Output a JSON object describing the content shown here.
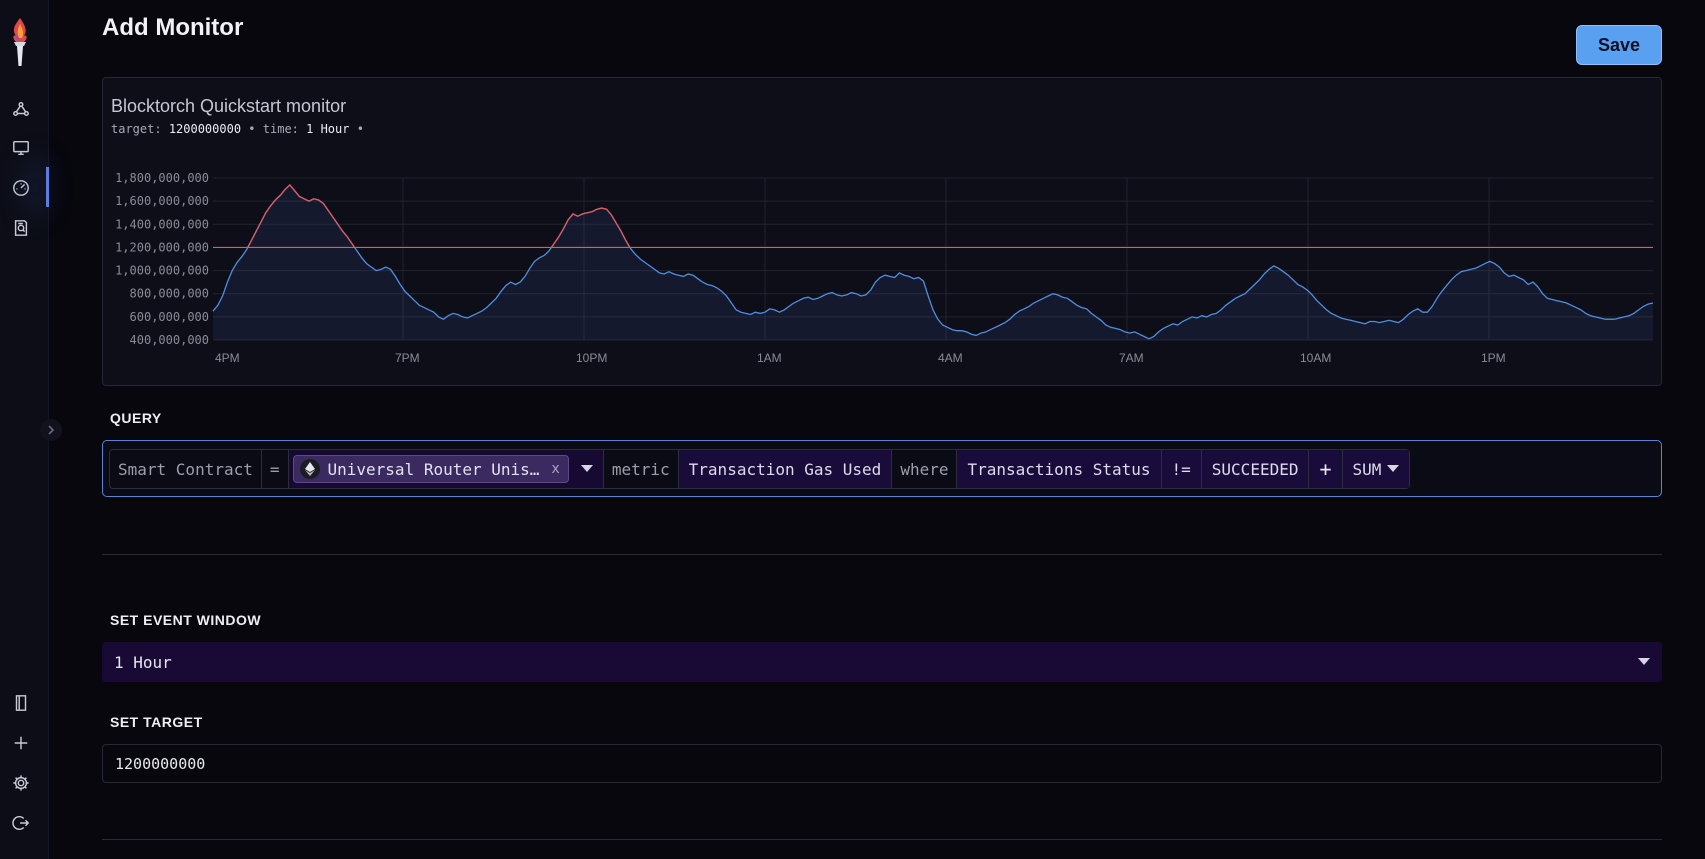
{
  "page": {
    "title": "Add Monitor",
    "save_label": "Save"
  },
  "sidebar": {
    "items": [
      {
        "name": "network",
        "icon": "network-icon"
      },
      {
        "name": "monitor",
        "icon": "desktop-icon"
      },
      {
        "name": "dashboard",
        "icon": "gauge-icon",
        "active": true
      },
      {
        "name": "reports",
        "icon": "document-search-icon"
      },
      {
        "name": "docs",
        "icon": "book-icon"
      },
      {
        "name": "add",
        "icon": "plus-icon"
      },
      {
        "name": "settings",
        "icon": "gear-icon"
      },
      {
        "name": "logout",
        "icon": "logout-icon"
      }
    ]
  },
  "chart_panel": {
    "title": "Blocktorch Quickstart monitor",
    "target_label": "target:",
    "target_value": "1200000000",
    "time_label": "time:",
    "time_value": "1 Hour",
    "separator": "•"
  },
  "chart_data": {
    "type": "line",
    "x_labels": [
      "4PM",
      "7PM",
      "10PM",
      "1AM",
      "4AM",
      "7AM",
      "10AM",
      "1PM"
    ],
    "y_ticks": [
      "1,800,000,000",
      "1,600,000,000",
      "1,400,000,000",
      "1,200,000,000",
      "1,000,000,000",
      "800,000,000",
      "600,000,000",
      "400,000,000"
    ],
    "ylim": [
      400000000,
      1800000000
    ],
    "threshold": 1200000000,
    "line_color": "#4f8ee0",
    "above_threshold_color": "#e05a5a",
    "grid": true,
    "series": [
      {
        "values": [
          650,
          700,
          780,
          900,
          1000,
          1070,
          1120,
          1180,
          1260,
          1340,
          1420,
          1500,
          1560,
          1610,
          1650,
          1700,
          1740,
          1690,
          1640,
          1620,
          1600,
          1620,
          1610,
          1580,
          1520,
          1460,
          1400,
          1340,
          1290,
          1230,
          1170,
          1110,
          1060,
          1030,
          1000,
          1010,
          1030,
          1010,
          950,
          880,
          820,
          780,
          740,
          700,
          680,
          660,
          640,
          600,
          580,
          610,
          630,
          620,
          600,
          590,
          610,
          630,
          650,
          680,
          720,
          760,
          820,
          870,
          900,
          880,
          900,
          950,
          1020,
          1080,
          1110,
          1130,
          1170,
          1230,
          1290,
          1360,
          1440,
          1490,
          1470,
          1490,
          1500,
          1510,
          1530,
          1540,
          1530,
          1480,
          1410,
          1340,
          1260,
          1190,
          1140,
          1100,
          1070,
          1040,
          1010,
          980,
          970,
          990,
          970,
          960,
          950,
          970,
          960,
          930,
          900,
          880,
          870,
          850,
          820,
          780,
          720,
          660,
          640,
          630,
          620,
          640,
          630,
          640,
          670,
          660,
          640,
          660,
          690,
          720,
          740,
          760,
          770,
          750,
          760,
          780,
          800,
          810,
          790,
          780,
          790,
          810,
          800,
          780,
          790,
          830,
          900,
          940,
          960,
          950,
          940,
          980,
          960,
          950,
          930,
          940,
          910,
          780,
          660,
          580,
          530,
          510,
          490,
          480,
          480,
          470,
          450,
          440,
          460,
          470,
          490,
          510,
          530,
          550,
          580,
          620,
          650,
          670,
          690,
          720,
          740,
          760,
          780,
          800,
          790,
          770,
          760,
          730,
          700,
          680,
          670,
          630,
          600,
          570,
          530,
          510,
          500,
          490,
          470,
          460,
          470,
          450,
          430,
          410,
          430,
          470,
          500,
          520,
          540,
          530,
          560,
          580,
          600,
          590,
          610,
          600,
          620,
          630,
          660,
          700,
          730,
          760,
          780,
          800,
          840,
          880,
          920,
          970,
          1010,
          1040,
          1020,
          990,
          960,
          920,
          880,
          860,
          830,
          790,
          740,
          700,
          660,
          630,
          610,
          590,
          580,
          570,
          560,
          550,
          540,
          560,
          560,
          550,
          560,
          570,
          560,
          550,
          580,
          620,
          650,
          670,
          640,
          640,
          690,
          760,
          820,
          870,
          920,
          960,
          990,
          1000,
          1010,
          1020,
          1040,
          1060,
          1080,
          1060,
          1030,
          980,
          950,
          960,
          940,
          920,
          880,
          900,
          860,
          800,
          760,
          750,
          740,
          730,
          720,
          700,
          680,
          660,
          630,
          610,
          600,
          590,
          580,
          580,
          580,
          590,
          600,
          610,
          630,
          660,
          690,
          710,
          720
        ]
      }
    ]
  },
  "query": {
    "section_label": "QUERY",
    "segments": [
      {
        "kind": "label",
        "text": "Smart Contract"
      },
      {
        "kind": "operator",
        "text": "="
      },
      {
        "kind": "chip",
        "text": "Universal Router Unis…",
        "icon": "ethereum-icon",
        "close": "x"
      },
      {
        "kind": "label",
        "text": "metric"
      },
      {
        "kind": "value",
        "text": "Transaction Gas Used"
      },
      {
        "kind": "label",
        "text": "where"
      },
      {
        "kind": "value",
        "text": "Transactions Status"
      },
      {
        "kind": "value",
        "text": "!="
      },
      {
        "kind": "value",
        "text": "SUCCEEDED"
      },
      {
        "kind": "add",
        "text": "+"
      },
      {
        "kind": "value",
        "text": "SUM"
      }
    ]
  },
  "event_window": {
    "section_label": "SET EVENT WINDOW",
    "selected": "1 Hour"
  },
  "target": {
    "section_label": "SET TARGET",
    "value": "1200000000"
  },
  "colors": {
    "background": "#07070d",
    "accent": "#5aa0f0",
    "purple": "#190a35",
    "query_border": "#5a84d6"
  }
}
